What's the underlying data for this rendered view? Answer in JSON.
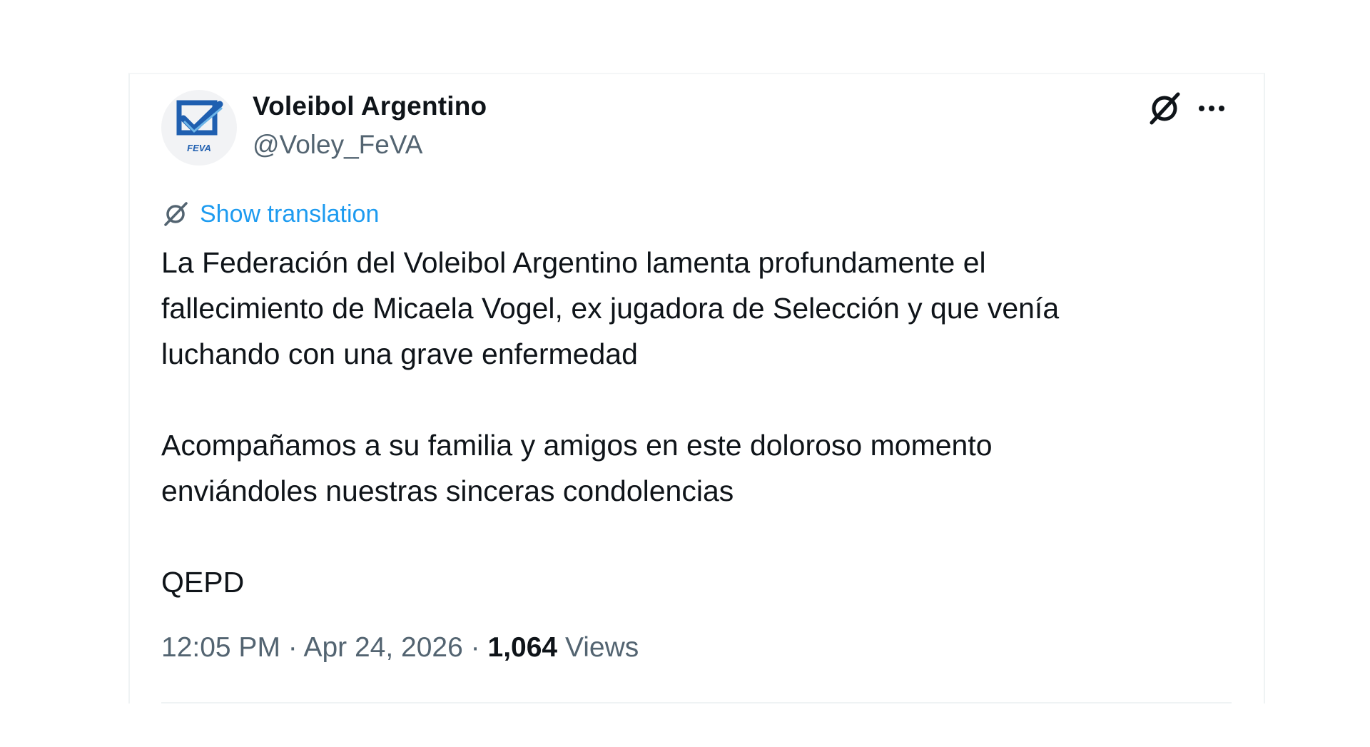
{
  "author": {
    "display_name": "Voleibol Argentino",
    "handle": "@Voley_FeVA",
    "avatar_label": "FEVA"
  },
  "translate": {
    "label": "Show translation"
  },
  "tweet": {
    "paragraphs": [
      "La Federación del Voleibol Argentino lamenta profundamente el\nfallecimiento de Micaela Vogel, ex jugadora de Selección y que venía\nluchando con una grave enfermedad",
      "Acompañamos a su familia y amigos en este doloroso momento\nenviándoles nuestras sinceras condolencias",
      "QEPD"
    ]
  },
  "meta": {
    "time": "12:05 PM",
    "separator": "·",
    "date": "Apr 24, 2026",
    "views_count": "1,064",
    "views_label": "Views"
  },
  "icons": {
    "grok": "grok-icon",
    "more": "more-icon",
    "translate": "translate-icon"
  },
  "colors": {
    "link": "#1d9bf0",
    "secondary_text": "#536471",
    "primary_text": "#0f1419",
    "avatar_blue": "#1f5fb0"
  }
}
